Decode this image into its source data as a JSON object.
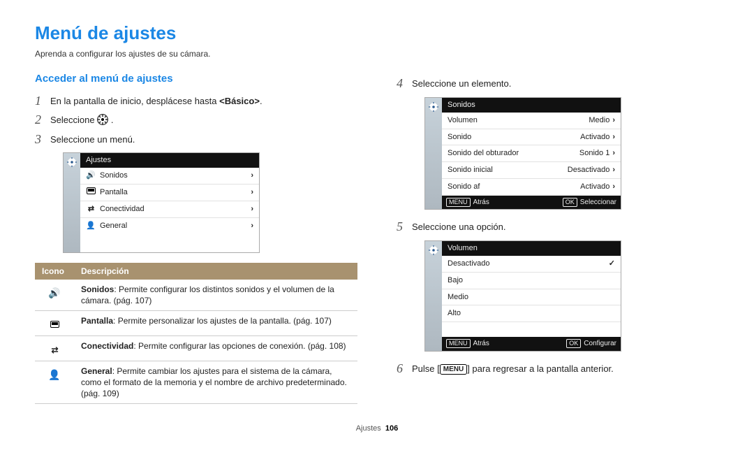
{
  "page": {
    "title": "Menú de ajustes",
    "intro": "Aprenda a configurar los ajustes de su cámara.",
    "footer_label": "Ajustes",
    "footer_page": "106"
  },
  "sec": {
    "subtitle": "Acceder al menú de ajustes",
    "s1a": "En la pantalla de inicio, desplácese hasta ",
    "s1b": "<Básico>",
    "s1c": ".",
    "s2a": "Seleccione ",
    "s2b": ".",
    "s3": "Seleccione un menú.",
    "s4": "Seleccione un elemento.",
    "s5": "Seleccione una opción.",
    "s6a": "Pulse [",
    "s6b": "] para regresar a la pantalla anterior.",
    "menu_badge": "MENU"
  },
  "cam1": {
    "hdr": "Ajustes",
    "r1": "Sonidos",
    "r2": "Pantalla",
    "r3": "Conectividad",
    "r4": "General"
  },
  "cam2": {
    "hdr": "Sonidos",
    "r1l": "Volumen",
    "r1v": "Medio",
    "r2l": "Sonido",
    "r2v": "Activado",
    "r3l": "Sonido del obturador",
    "r3v": "Sonido 1",
    "r4l": "Sonido inicial",
    "r4v": "Desactivado",
    "r5l": "Sonido af",
    "r5v": "Activado",
    "f_back_badge": "MENU",
    "f_back": "Atrás",
    "f_ok_badge": "OK",
    "f_ok": "Seleccionar"
  },
  "cam3": {
    "hdr": "Volumen",
    "r1": "Desactivado",
    "r2": "Bajo",
    "r3": "Medio",
    "r4": "Alto",
    "f_back_badge": "MENU",
    "f_back": "Atrás",
    "f_ok_badge": "OK",
    "f_ok": "Configurar"
  },
  "tbl": {
    "h1": "Icono",
    "h2": "Descripción",
    "d1b": "Sonidos",
    "d1t": ": Permite configurar los distintos sonidos y el volumen de la cámara. (pág. 107)",
    "d2b": "Pantalla",
    "d2t": ": Permite personalizar los ajustes de la pantalla. (pág. 107)",
    "d3b": "Conectividad",
    "d3t": ": Permite configurar las opciones de conexión. (pág. 108)",
    "d4b": "General",
    "d4t": ": Permite cambiar los ajustes para el sistema de la cámara, como el formato de la memoria y el nombre de archivo predeterminado. (pág. 109)"
  }
}
